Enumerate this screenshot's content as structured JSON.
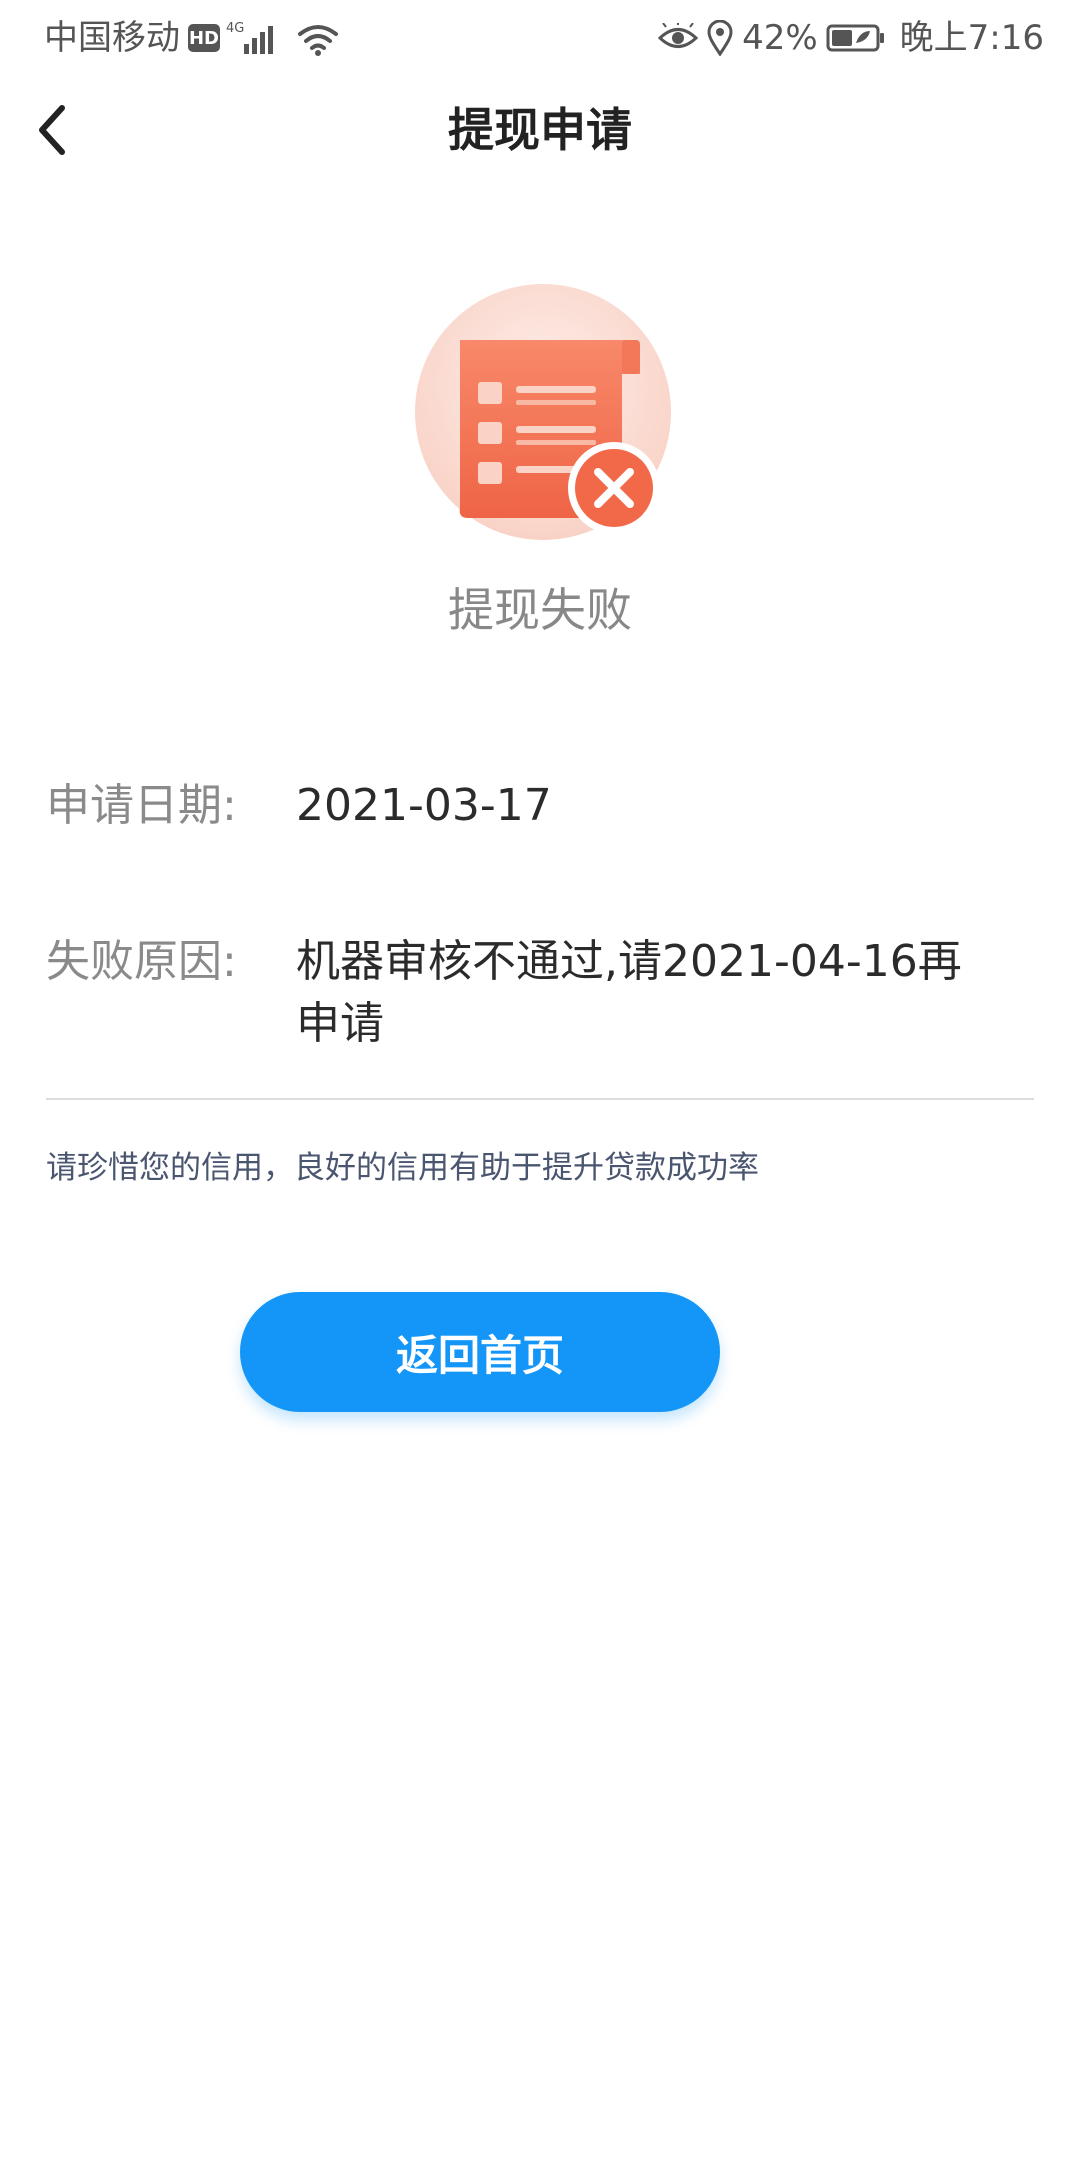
{
  "status_bar": {
    "carrier": "中国移动",
    "hd_badge": "HD",
    "network": "4G",
    "battery_percent": "42%",
    "time": "晚上7:16",
    "icons": [
      "hd-icon",
      "signal-icon",
      "wifi-icon",
      "eye-icon",
      "location-icon",
      "battery-icon"
    ]
  },
  "nav": {
    "back_icon": "chevron-left-icon",
    "title": "提现申请"
  },
  "result": {
    "icon": "failed-document-icon",
    "status": "提现失败",
    "colors": {
      "accent": "#f2694a",
      "circle_bg": "#fde3dc"
    }
  },
  "details": {
    "apply_date_label": "申请日期:",
    "apply_date_value": "2021-03-17",
    "reason_label": "失败原因:",
    "reason_value_line1": "机器审核不通过,请2021-04-16再",
    "reason_value_line2": "申请"
  },
  "tip": {
    "text": "请珍惜您的信用，良好的信用有助于提升贷款成功率"
  },
  "actions": {
    "home_button_label": "返回首页",
    "home_button_color": "#1396f7"
  }
}
